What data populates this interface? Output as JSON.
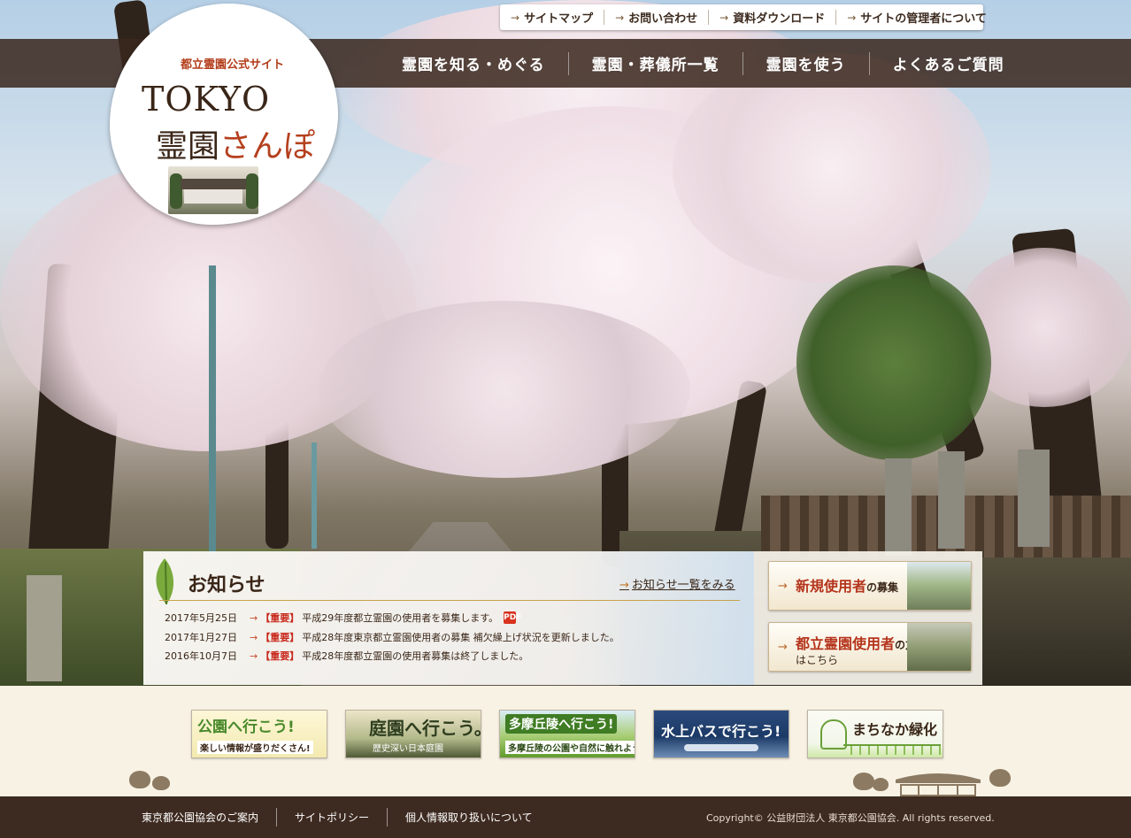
{
  "utility_links": [
    {
      "label": "サイトマップ"
    },
    {
      "label": "お問い合わせ"
    },
    {
      "label": "資料ダウンロード"
    },
    {
      "label": "サイトの管理者について"
    }
  ],
  "nav": [
    {
      "label": "霊園を知る・めぐる"
    },
    {
      "label": "霊園・葬儀所一覧"
    },
    {
      "label": "霊園を使う"
    },
    {
      "label": "よくあるご質問"
    }
  ],
  "logo": {
    "subtitle": "都立霊園公式サイト",
    "title_en": "TOKYO",
    "title_jp_1": "霊園",
    "title_jp_2": "さんぽ"
  },
  "news": {
    "title": "お知らせ",
    "more_link": "お知らせ一覧をみる",
    "items": [
      {
        "date": "2017年5月25日",
        "tag": "【重要】",
        "text": "平成29年度都立霊園の使用者を募集します。",
        "pdf": "PDF"
      },
      {
        "date": "2017年1月27日",
        "tag": "【重要】",
        "text": "平成28年度東京都立霊園使用者の募集 補欠繰上げ状況を更新しました。"
      },
      {
        "date": "2016年10月7日",
        "tag": "【重要】",
        "text": "平成28年度都立霊園の使用者募集は終了しました。"
      }
    ]
  },
  "side_buttons": [
    {
      "main": "新規使用者",
      "small": "の募集",
      "sub": ""
    },
    {
      "main": "都立霊園使用者",
      "small": "の方",
      "sub": "はこちら"
    }
  ],
  "banners": [
    {
      "line1": "公園へ行こう!",
      "line2": "楽しい情報が盛りだくさん!"
    },
    {
      "line1": "庭園へ行こう。",
      "line2": "歴史深い日本庭園"
    },
    {
      "line1": "多摩丘陵へ行こう!",
      "line2": "多摩丘陵の公園や自然に触れよう!"
    },
    {
      "line1": "水上バスで行こう!",
      "line2": ""
    },
    {
      "line1": "まちなか緑化",
      "line2": ""
    }
  ],
  "footer": {
    "links": [
      {
        "label": "東京都公園協会のご案内"
      },
      {
        "label": "サイトポリシー"
      },
      {
        "label": "個人情報取り扱いについて"
      }
    ],
    "copyright": "Copyright© 公益財団法人 東京都公園協会. All rights reserved."
  },
  "colors": {
    "nav_bg": "#3a281e",
    "footer_bg": "#3d2a20",
    "accent_red": "#b5341c",
    "blossom": "#f3e4ea"
  },
  "icons": {
    "utility_arrow": "arrow-right-icon",
    "news_leaf": "leaf-icon",
    "pdf": "pdf-icon"
  }
}
